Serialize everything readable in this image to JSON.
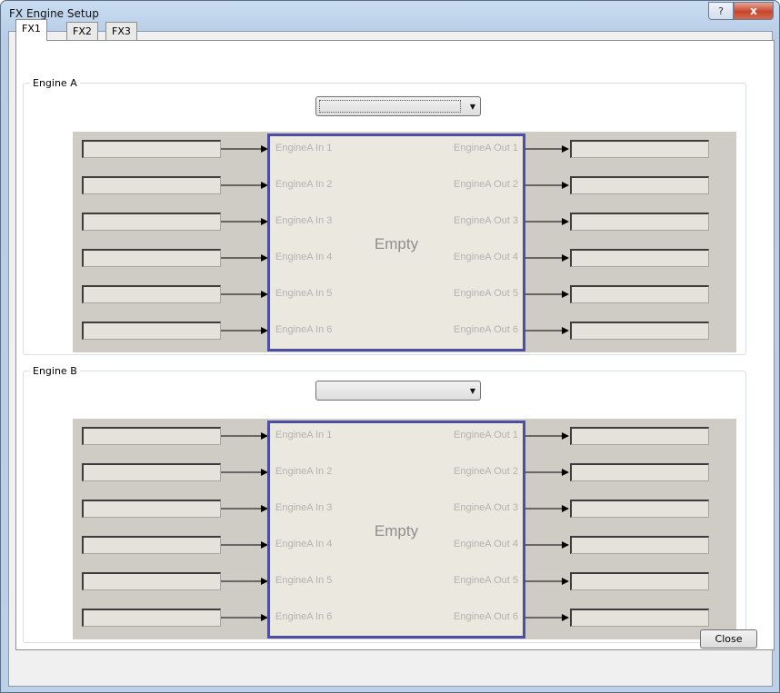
{
  "window": {
    "title": "FX Engine Setup",
    "help_label": "?",
    "close_label": "x"
  },
  "tabs": [
    {
      "label": "FX1",
      "active": true
    },
    {
      "label": "FX2",
      "active": false
    },
    {
      "label": "FX3",
      "active": false
    }
  ],
  "engines": [
    {
      "group_title": "Engine A",
      "selected_engine": "",
      "engine_name": "Empty",
      "inputs": [
        "EngineA In 1",
        "EngineA In 2",
        "EngineA In 3",
        "EngineA In 4",
        "EngineA In 5",
        "EngineA In 6"
      ],
      "outputs": [
        "EngineA Out 1",
        "EngineA Out 2",
        "EngineA Out 3",
        "EngineA Out 4",
        "EngineA Out 5",
        "EngineA Out 6"
      ],
      "input_values": [
        "",
        "",
        "",
        "",
        "",
        ""
      ],
      "output_values": [
        "",
        "",
        "",
        "",
        "",
        ""
      ]
    },
    {
      "group_title": "Engine B",
      "selected_engine": "",
      "engine_name": "Empty",
      "inputs": [
        "EngineA In 1",
        "EngineA In 2",
        "EngineA In 3",
        "EngineA In 4",
        "EngineA In 5",
        "EngineA In 6"
      ],
      "outputs": [
        "EngineA Out 1",
        "EngineA Out 2",
        "EngineA Out 3",
        "EngineA Out 4",
        "EngineA Out 5",
        "EngineA Out 6"
      ],
      "input_values": [
        "",
        "",
        "",
        "",
        "",
        ""
      ],
      "output_values": [
        "",
        "",
        "",
        "",
        "",
        ""
      ]
    }
  ],
  "footer": {
    "close_button": "Close"
  },
  "icons": {
    "combo_arrow": "chevron-down-icon"
  },
  "colors": {
    "engine_border": "#4b4ea2",
    "panel_bg": "#cfccc6",
    "engine_bg": "#ebe8df"
  }
}
